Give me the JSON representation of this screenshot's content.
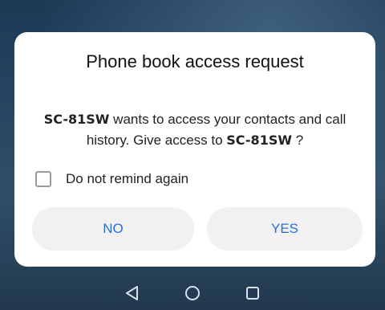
{
  "dialog": {
    "title": "Phone book access request",
    "message": {
      "device_name_1": "SC-81SW",
      "text_part_1": " wants to access your contacts and call history. Give access to ",
      "device_name_2": "SC-81SW",
      "text_part_2": " ?"
    },
    "checkbox": {
      "label": "Do not remind again",
      "checked": false
    },
    "buttons": {
      "no_label": "NO",
      "yes_label": "YES"
    }
  },
  "navbar": {
    "icons": [
      "back-icon",
      "home-icon",
      "recents-icon"
    ]
  },
  "colors": {
    "accent": "#2b6fd6",
    "dialog_background": "#ffffff",
    "button_background": "#f1f1f1",
    "screen_background": "#24445f",
    "nav_icon": "#d8e0e8"
  }
}
